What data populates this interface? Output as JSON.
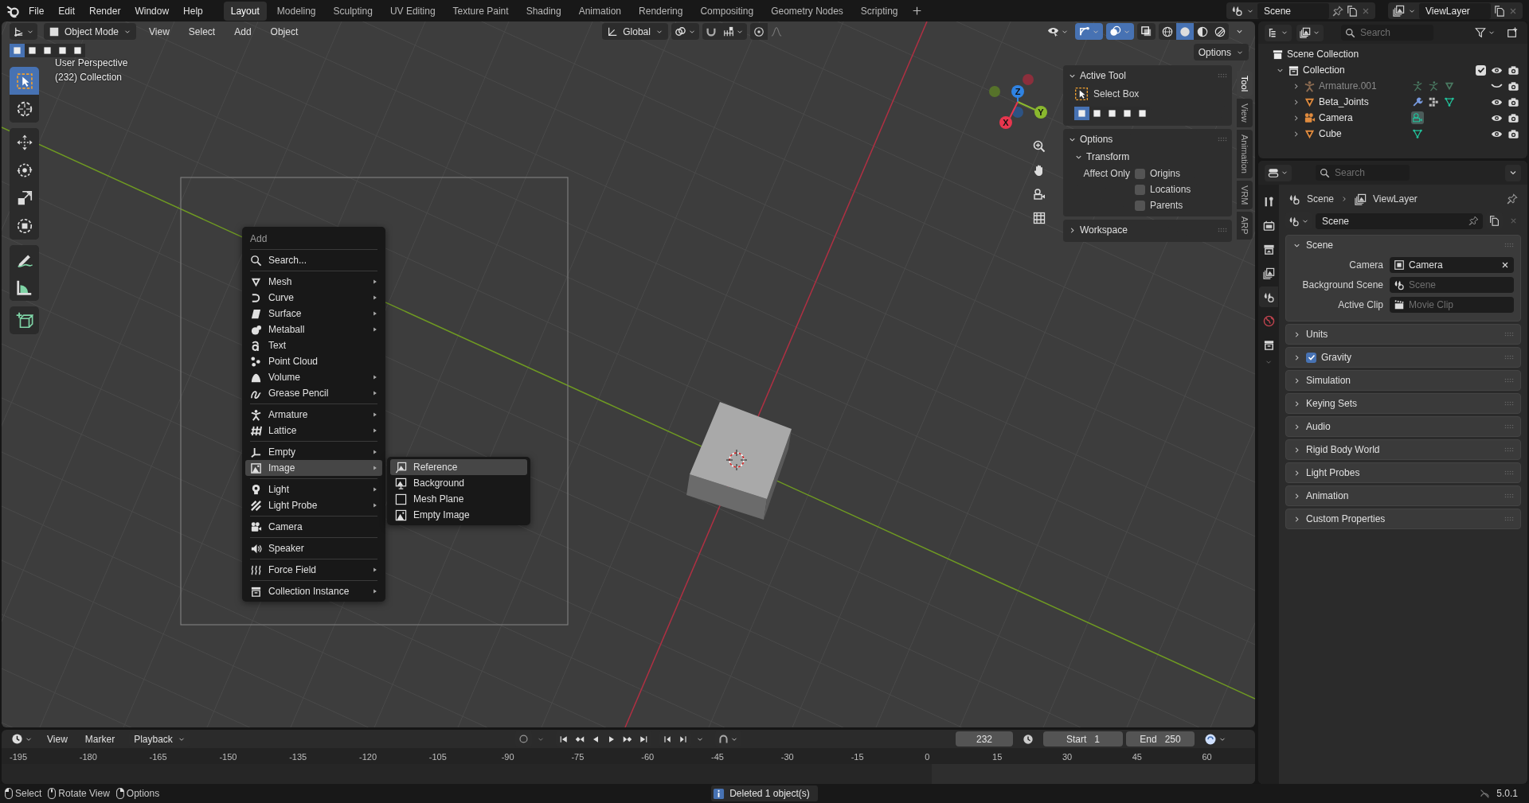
{
  "top_bar": {
    "menus": [
      "File",
      "Edit",
      "Render",
      "Window",
      "Help"
    ],
    "workspaces": [
      {
        "label": "Layout",
        "selected": true
      },
      {
        "label": "Modeling",
        "selected": false
      },
      {
        "label": "Sculpting",
        "selected": false
      },
      {
        "label": "UV Editing",
        "selected": false
      },
      {
        "label": "Texture Paint",
        "selected": false
      },
      {
        "label": "Shading",
        "selected": false
      },
      {
        "label": "Animation",
        "selected": false
      },
      {
        "label": "Rendering",
        "selected": false
      },
      {
        "label": "Compositing",
        "selected": false
      },
      {
        "label": "Geometry Nodes",
        "selected": false
      },
      {
        "label": "Scripting",
        "selected": false
      }
    ],
    "scene": "Scene",
    "view_layer": "ViewLayer"
  },
  "viewport": {
    "mode": "Object Mode",
    "menus": [
      "View",
      "Select",
      "Add",
      "Object"
    ],
    "orientation": "Global",
    "toggles": [
      {
        "kind": "gizmo",
        "on": true
      },
      {
        "kind": "overlay",
        "on": true
      },
      {
        "kind": "xray",
        "on": false
      }
    ],
    "shading": [
      {
        "kind": "wireframe",
        "selected": false
      },
      {
        "kind": "solid",
        "selected": true
      },
      {
        "kind": "material",
        "selected": false
      },
      {
        "kind": "rendered",
        "selected": false
      }
    ],
    "select_modes": [
      {
        "selected": true
      },
      {
        "selected": false
      },
      {
        "selected": false
      },
      {
        "selected": false
      },
      {
        "selected": false
      }
    ],
    "options": "Options",
    "info": [
      "User Perspective",
      "(232) Collection"
    ],
    "tool_groups": [
      [
        {
          "kind": "select-box",
          "selected": true
        },
        {
          "kind": "cursor",
          "selected": false
        }
      ],
      [
        {
          "kind": "move",
          "selected": false
        },
        {
          "kind": "rotate",
          "selected": false
        },
        {
          "kind": "scale",
          "selected": false
        },
        {
          "kind": "transform",
          "selected": false
        }
      ],
      [
        {
          "kind": "annotate",
          "selected": false
        },
        {
          "kind": "measure",
          "selected": false
        }
      ],
      [
        {
          "kind": "add-cube",
          "selected": false
        }
      ]
    ],
    "gizmo": {
      "x": "X",
      "y": "Y",
      "z": "Z"
    }
  },
  "add_menu": {
    "title": "Add",
    "sections": [
      [
        {
          "label": "Search...",
          "kind": "search",
          "submenu": false,
          "selected": false
        }
      ],
      [
        {
          "label": "Mesh",
          "kind": "mesh",
          "submenu": true,
          "selected": false
        },
        {
          "label": "Curve",
          "kind": "curve",
          "submenu": true,
          "selected": false
        },
        {
          "label": "Surface",
          "kind": "surface",
          "submenu": true,
          "selected": false
        },
        {
          "label": "Metaball",
          "kind": "metaball",
          "submenu": true,
          "selected": false
        },
        {
          "label": "Text",
          "kind": "text",
          "submenu": false,
          "selected": false
        },
        {
          "label": "Point Cloud",
          "kind": "pointcloud",
          "submenu": false,
          "selected": false
        },
        {
          "label": "Volume",
          "kind": "volume",
          "submenu": true,
          "selected": false
        },
        {
          "label": "Grease Pencil",
          "kind": "greasepencil",
          "submenu": true,
          "selected": false
        }
      ],
      [
        {
          "label": "Armature",
          "kind": "armature",
          "submenu": true,
          "selected": false
        },
        {
          "label": "Lattice",
          "kind": "lattice",
          "submenu": true,
          "selected": false
        }
      ],
      [
        {
          "label": "Empty",
          "kind": "empty",
          "submenu": true,
          "selected": false
        },
        {
          "label": "Image",
          "kind": "image",
          "submenu": true,
          "selected": true
        }
      ],
      [
        {
          "label": "Light",
          "kind": "light",
          "submenu": true,
          "selected": false
        },
        {
          "label": "Light Probe",
          "kind": "lightprobe",
          "submenu": true,
          "selected": false
        }
      ],
      [
        {
          "label": "Camera",
          "kind": "camera",
          "submenu": false,
          "selected": false
        }
      ],
      [
        {
          "label": "Speaker",
          "kind": "speaker",
          "submenu": false,
          "selected": false
        }
      ],
      [
        {
          "label": "Force Field",
          "kind": "forcefield",
          "submenu": true,
          "selected": false
        }
      ],
      [
        {
          "label": "Collection Instance",
          "kind": "collection-instance",
          "submenu": true,
          "selected": false
        }
      ]
    ]
  },
  "image_submenu": {
    "items": [
      {
        "label": "Reference",
        "kind": "reference",
        "selected": true
      },
      {
        "label": "Background",
        "kind": "background",
        "selected": false
      },
      {
        "label": "Mesh Plane",
        "kind": "plane",
        "selected": false
      },
      {
        "label": "Empty Image",
        "kind": "empty-image",
        "selected": false
      }
    ]
  },
  "sidebar": {
    "tabs": [
      {
        "label": "Tool",
        "selected": true
      },
      {
        "label": "View",
        "selected": false
      },
      {
        "label": "Animation",
        "selected": false
      },
      {
        "label": "VRM",
        "selected": false
      },
      {
        "label": "ARP",
        "selected": false
      }
    ],
    "panels": [
      {
        "title": "Active Tool",
        "expanded": true,
        "tool": "Select Box",
        "modes": [
          {
            "selected": true
          },
          {
            "selected": false
          },
          {
            "selected": false
          },
          {
            "selected": false
          },
          {
            "selected": false
          }
        ]
      },
      {
        "title": "Options",
        "expanded": true,
        "subpanel": {
          "title": "Transform",
          "expanded": true
        },
        "group_label": "Affect Only",
        "checks": [
          {
            "label": "Origins",
            "checked": false
          },
          {
            "label": "Locations",
            "checked": false
          },
          {
            "label": "Parents",
            "checked": false
          }
        ]
      },
      {
        "title": "Workspace",
        "expanded": false
      }
    ]
  },
  "outliner": {
    "search_placeholder": "Search",
    "tree": [
      {
        "label": "Scene Collection",
        "kind": "scene-collection",
        "children": [
          {
            "label": "Collection",
            "kind": "collection",
            "expanded": true,
            "checked": true,
            "visible": true,
            "children": [
              {
                "label": "Armature.001",
                "kind": "armature",
                "expanded": false,
                "visible": false,
                "badges": [
                  {
                    "kind": "pose",
                    "selected": false
                  },
                  {
                    "kind": "pose",
                    "selected": false
                  },
                  {
                    "kind": "mesh-object",
                    "selected": false
                  }
                ]
              },
              {
                "label": "Beta_Joints",
                "kind": "mesh",
                "expanded": false,
                "visible": true,
                "badges": [
                  {
                    "kind": "modifier",
                    "selected": false
                  },
                  {
                    "kind": "vertex-groups",
                    "selected": false
                  },
                  {
                    "kind": "mesh-data",
                    "selected": false
                  }
                ]
              },
              {
                "label": "Camera",
                "kind": "camera",
                "expanded": false,
                "visible": true,
                "badges": [
                  {
                    "kind": "camera-data",
                    "selected": true
                  }
                ]
              },
              {
                "label": "Cube",
                "kind": "mesh",
                "expanded": false,
                "visible": true,
                "badges": [
                  {
                    "kind": "mesh-data",
                    "selected": false
                  }
                ]
              }
            ]
          }
        ]
      }
    ]
  },
  "properties": {
    "search_placeholder": "Search",
    "tabs": [
      {
        "kind": "tool",
        "selected": false
      },
      {
        "kind": "render",
        "selected": false
      },
      {
        "kind": "output",
        "selected": false
      },
      {
        "kind": "view-layer",
        "selected": false
      },
      {
        "kind": "scene",
        "selected": true
      },
      {
        "kind": "world",
        "selected": false
      },
      {
        "kind": "collection",
        "selected": false
      }
    ],
    "breadcrumb": [
      {
        "kind": "scene",
        "label": "Scene"
      },
      {
        "kind": "view-layer",
        "label": "ViewLayer"
      }
    ],
    "datablock": "Scene",
    "panels": [
      {
        "label": "Scene",
        "kind": "plain",
        "expanded": true,
        "fields": [
          {
            "label": "Camera",
            "kind": "camera-object",
            "value": "Camera"
          },
          {
            "label": "Background Scene",
            "kind": "scene",
            "placeholder": "Scene"
          },
          {
            "label": "Active Clip",
            "kind": "clip",
            "placeholder": "Movie Clip"
          }
        ]
      },
      {
        "label": "Units",
        "kind": "plain",
        "expanded": false
      },
      {
        "label": "Gravity",
        "kind": "toggle",
        "checked": true,
        "expanded": false
      },
      {
        "label": "Simulation",
        "kind": "plain",
        "expanded": false
      },
      {
        "label": "Keying Sets",
        "kind": "plain",
        "expanded": false
      },
      {
        "label": "Audio",
        "kind": "plain",
        "expanded": false
      },
      {
        "label": "Rigid Body World",
        "kind": "plain",
        "expanded": false
      },
      {
        "label": "Light Probes",
        "kind": "plain",
        "expanded": false
      },
      {
        "label": "Animation",
        "kind": "plain",
        "expanded": false
      },
      {
        "label": "Custom Properties",
        "kind": "plain",
        "expanded": false
      }
    ]
  },
  "timeline": {
    "menus": [
      "View",
      "Marker",
      "Playback"
    ],
    "current_frame": "232",
    "start_label": "Start",
    "start": "1",
    "end_label": "End",
    "end": "250",
    "ruler": [
      "-195",
      "-180",
      "-165",
      "-150",
      "-135",
      "-120",
      "-105",
      "-90",
      "-75",
      "-60",
      "-45",
      "-30",
      "-15",
      "0",
      "15",
      "30",
      "45",
      "60"
    ]
  },
  "status_bar": {
    "hints": [
      {
        "kind": "left-click",
        "label": "Select"
      },
      {
        "kind": "middle-click",
        "label": "Rotate View"
      },
      {
        "kind": "right-click",
        "label": "Options"
      }
    ],
    "report": "Deleted 1 object(s)",
    "version": "5.0.1"
  }
}
